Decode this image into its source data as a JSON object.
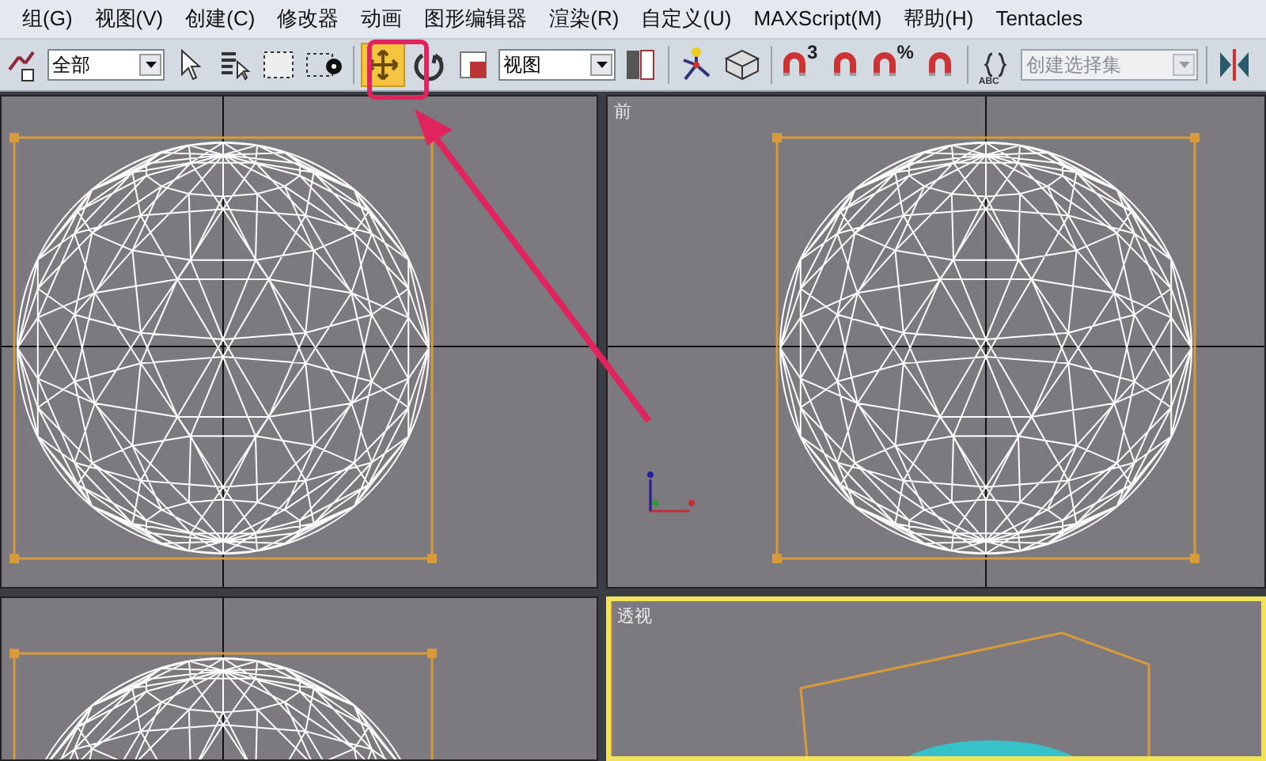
{
  "menu": [
    {
      "label": "组(G)"
    },
    {
      "label": "视图(V)"
    },
    {
      "label": "创建(C)"
    },
    {
      "label": "修改器"
    },
    {
      "label": "动画"
    },
    {
      "label": "图形编辑器"
    },
    {
      "label": "渲染(R)"
    },
    {
      "label": "自定义(U)"
    },
    {
      "label": "MAXScript(M)"
    },
    {
      "label": "帮助(H)"
    },
    {
      "label": "Tentacles"
    }
  ],
  "toolbar": [
    {
      "kind": "link",
      "selected": false
    },
    {
      "kind": "dropdown",
      "value": "全部"
    },
    {
      "kind": "pointer",
      "selected": false
    },
    {
      "kind": "list",
      "selected": false
    },
    {
      "kind": "region",
      "selected": false
    },
    {
      "kind": "crossing",
      "selected": false
    },
    {
      "kind": "separator"
    },
    {
      "kind": "move",
      "selected": true
    },
    {
      "kind": "rotate",
      "selected": false
    },
    {
      "kind": "scale",
      "selected": false
    },
    {
      "kind": "dropdown",
      "value": "视图"
    },
    {
      "kind": "pivot",
      "selected": false
    },
    {
      "kind": "separator"
    },
    {
      "kind": "manipulate",
      "selected": false
    },
    {
      "kind": "keyboard",
      "selected": false
    },
    {
      "kind": "separator"
    },
    {
      "kind": "snap",
      "selected": false,
      "label": "3"
    },
    {
      "kind": "angle",
      "selected": false
    },
    {
      "kind": "percent",
      "selected": false,
      "label": "%"
    },
    {
      "kind": "spinner",
      "selected": false
    },
    {
      "kind": "separator"
    },
    {
      "kind": "braces",
      "selected": false,
      "label": "ABC"
    },
    {
      "kind": "field",
      "placeholder": "创建选择集"
    },
    {
      "kind": "separator"
    },
    {
      "kind": "mirror",
      "selected": false
    }
  ],
  "viewports": [
    {
      "kind": "ortho",
      "active": false,
      "tripod": false
    },
    {
      "kind": "ortho",
      "label": "前",
      "active": false,
      "tripod": true
    },
    {
      "kind": "ortho",
      "active": false,
      "tripod": false
    },
    {
      "kind": "perspective",
      "label": "透视",
      "active": true,
      "tripod": false
    }
  ],
  "annotation": {
    "highlight": true
  }
}
